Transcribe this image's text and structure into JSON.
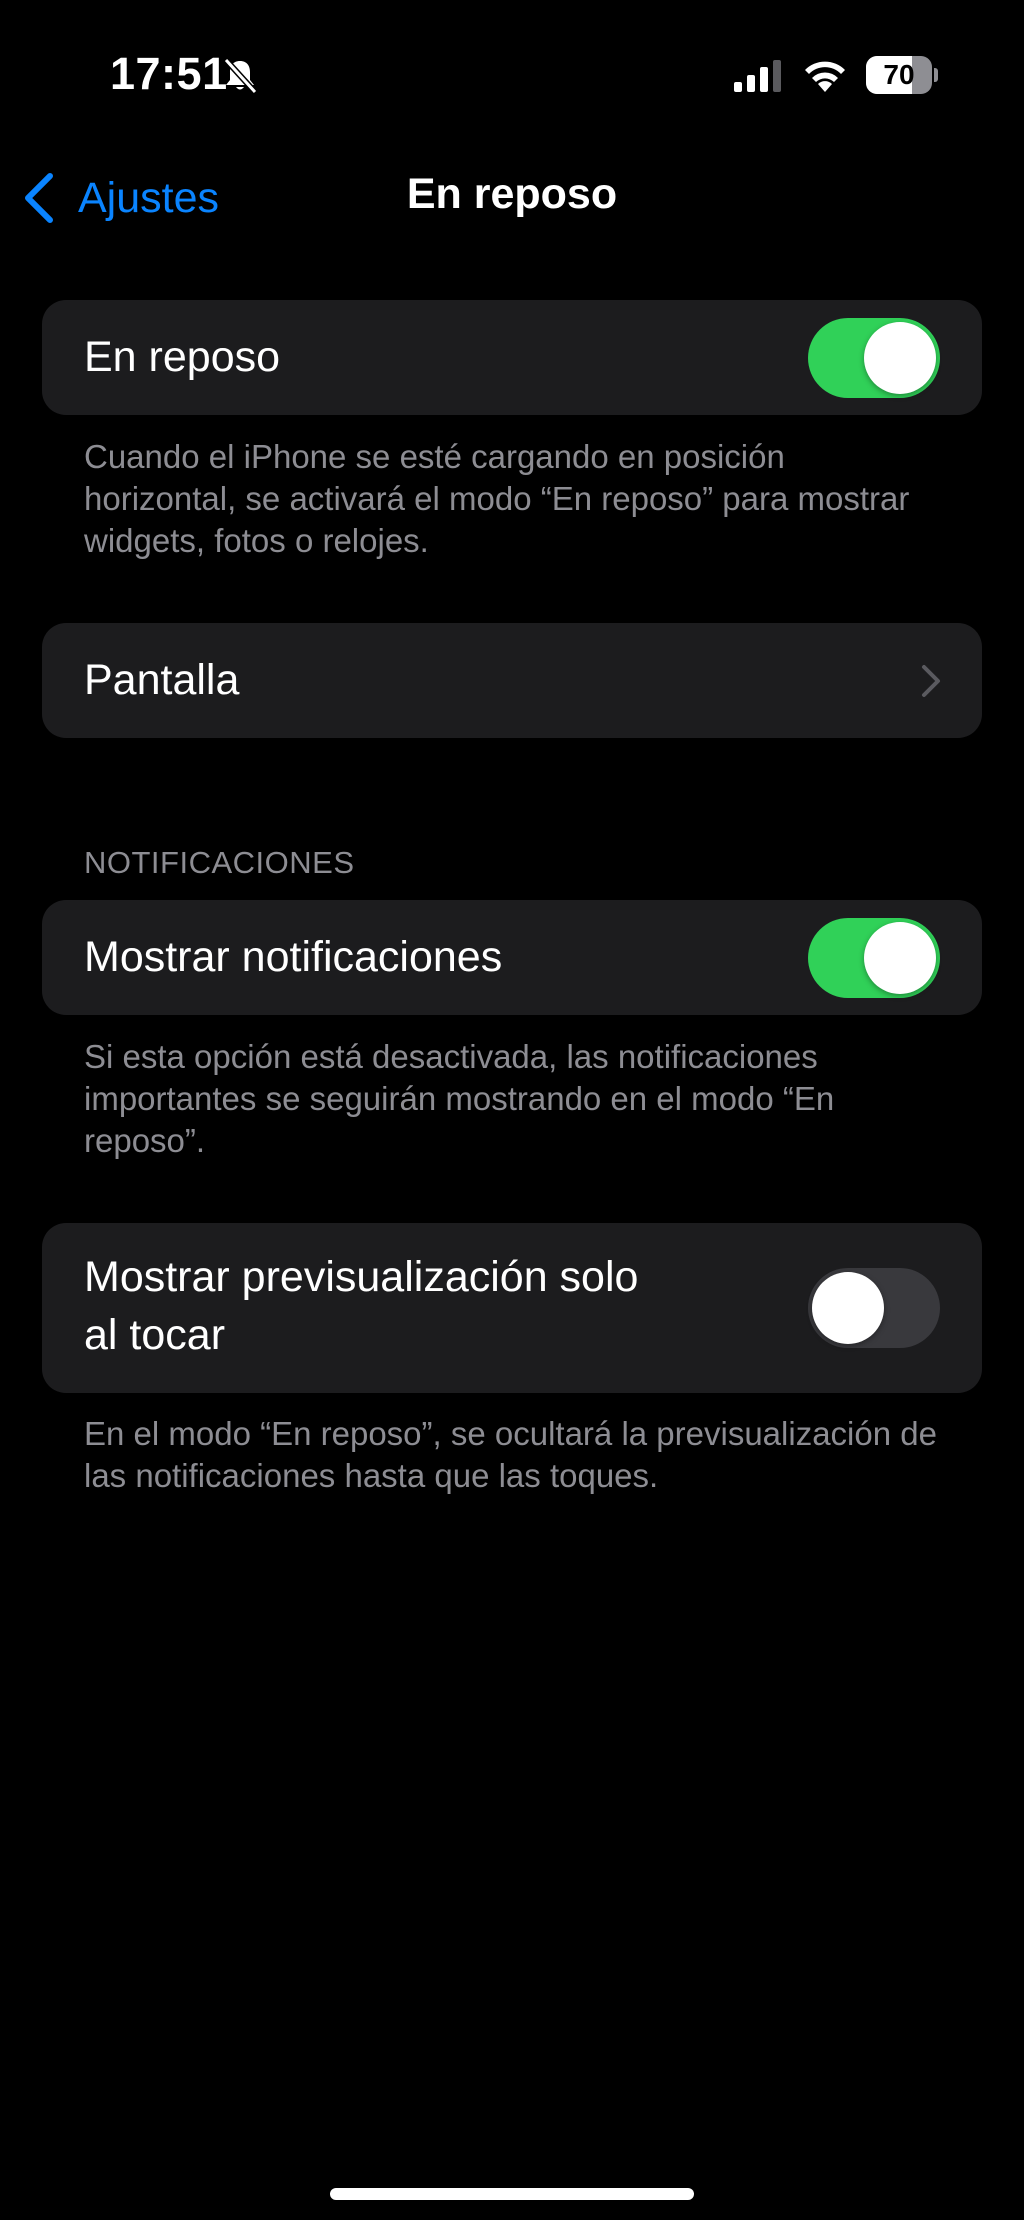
{
  "status_bar": {
    "time": "17:51",
    "battery_level": "70",
    "battery_fraction": 0.7,
    "icons": [
      "bell-slash-icon",
      "signal-icon",
      "wifi-icon",
      "battery-icon"
    ]
  },
  "nav": {
    "back_label": "Ajustes",
    "title": "En reposo"
  },
  "standby": {
    "label": "En reposo",
    "enabled": true,
    "footer": "Cuando el iPhone se esté cargando en posición horizontal, se activará el modo “En reposo” para mostrar widgets, fotos o relojes."
  },
  "display": {
    "label": "Pantalla"
  },
  "notifications": {
    "header": "NOTIFICACIONES",
    "show_label": "Mostrar notificaciones",
    "show_enabled": true,
    "show_footer": "Si esta opción está desactivada, las notificaciones importantes se seguirán mostrando en el modo “En reposo”.",
    "preview_label_line1": "Mostrar previsualización solo",
    "preview_label_line2": "al tocar",
    "preview_enabled": false,
    "preview_footer": "En el modo “En reposo”, se ocultará la previsualización de las notificaciones hasta que las toques."
  },
  "colors": {
    "accent": "#0a84ff",
    "toggle_on": "#30d158",
    "toggle_off": "#39393d",
    "group_bg": "#1c1c1e",
    "secondary_text": "#8d8d93"
  }
}
